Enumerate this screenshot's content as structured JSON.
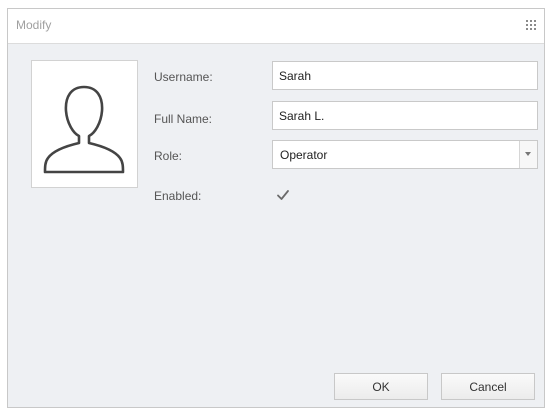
{
  "dialog": {
    "title": "Modify",
    "title_icon": "grip-icon"
  },
  "avatar": {
    "icon": "user-silhouette-icon"
  },
  "form": {
    "username_label": "Username:",
    "username_value": "Sarah",
    "fullname_label": "Full Name:",
    "fullname_value": "Sarah L.",
    "role_label": "Role:",
    "role_value": "Operator",
    "enabled_label": "Enabled:",
    "enabled_checked": true
  },
  "buttons": {
    "ok_label": "OK",
    "cancel_label": "Cancel"
  }
}
